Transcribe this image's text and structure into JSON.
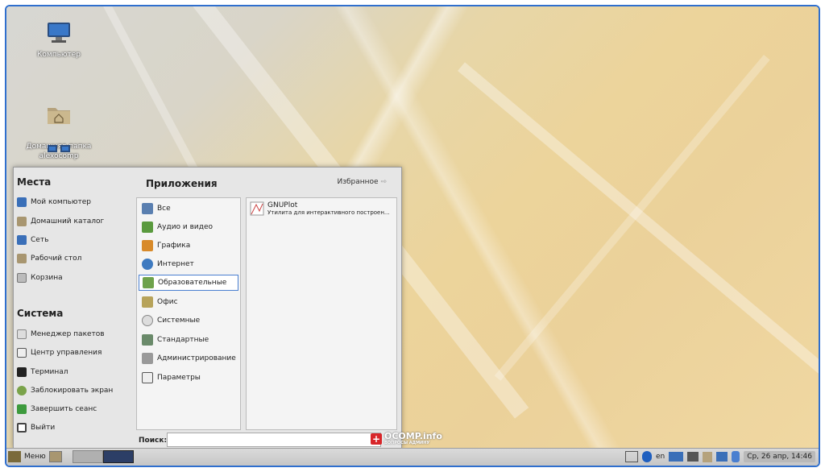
{
  "desktop": {
    "icons": [
      {
        "label": "Компьютер",
        "icon": "computer-icon"
      },
      {
        "label": "Домашняя папка\nalexocomp",
        "icon": "home-folder-icon"
      },
      {
        "label": "",
        "icon": "network-icon"
      }
    ]
  },
  "menu": {
    "places": {
      "title": "Места",
      "items": [
        {
          "label": "Мой компьютер",
          "icon": "computer-icon"
        },
        {
          "label": "Домашний каталог",
          "icon": "folder-icon"
        },
        {
          "label": "Сеть",
          "icon": "network-icon"
        },
        {
          "label": "Рабочий стол",
          "icon": "folder-icon"
        },
        {
          "label": "Корзина",
          "icon": "trash-icon"
        }
      ]
    },
    "system": {
      "title": "Система",
      "items": [
        {
          "label": "Менеджер пакетов",
          "icon": "package-icon"
        },
        {
          "label": "Центр управления",
          "icon": "control-center-icon"
        },
        {
          "label": "Терминал",
          "icon": "terminal-icon"
        },
        {
          "label": "Заблокировать экран",
          "icon": "lock-screen-icon"
        },
        {
          "label": "Завершить сеанс",
          "icon": "logout-icon"
        },
        {
          "label": "Выйти",
          "icon": "exit-icon"
        }
      ]
    },
    "apps": {
      "title": "Приложения",
      "favorites_label": "Избранное",
      "categories": [
        {
          "label": "Все",
          "icon": "all-apps-icon"
        },
        {
          "label": "Аудио и видео",
          "icon": "multimedia-icon"
        },
        {
          "label": "Графика",
          "icon": "graphics-icon"
        },
        {
          "label": "Интернет",
          "icon": "internet-icon"
        },
        {
          "label": "Образовательные",
          "icon": "education-icon",
          "selected": true
        },
        {
          "label": "Офис",
          "icon": "office-icon"
        },
        {
          "label": "Системные",
          "icon": "system-icon"
        },
        {
          "label": "Стандартные",
          "icon": "accessories-icon"
        },
        {
          "label": "Администрирование",
          "icon": "administration-icon"
        },
        {
          "label": "Параметры",
          "icon": "settings-icon"
        }
      ],
      "entries": [
        {
          "name": "GNUPlot",
          "description": "Утилита для интерактивного построен...",
          "icon": "gnuplot-icon"
        }
      ]
    },
    "search": {
      "label": "Поиск:",
      "value": ""
    }
  },
  "taskbar": {
    "menu_label": "Меню",
    "layout": "en",
    "clock": "Ср, 26 апр, 14:46"
  },
  "watermark": {
    "text": "OCOMP.info",
    "sub": "ВОПРОСЫ АДМИНУ"
  },
  "colors": {
    "frame": "#2f6fce",
    "selection": "#4a7fd0",
    "taskbar": "#cfcfcf"
  }
}
